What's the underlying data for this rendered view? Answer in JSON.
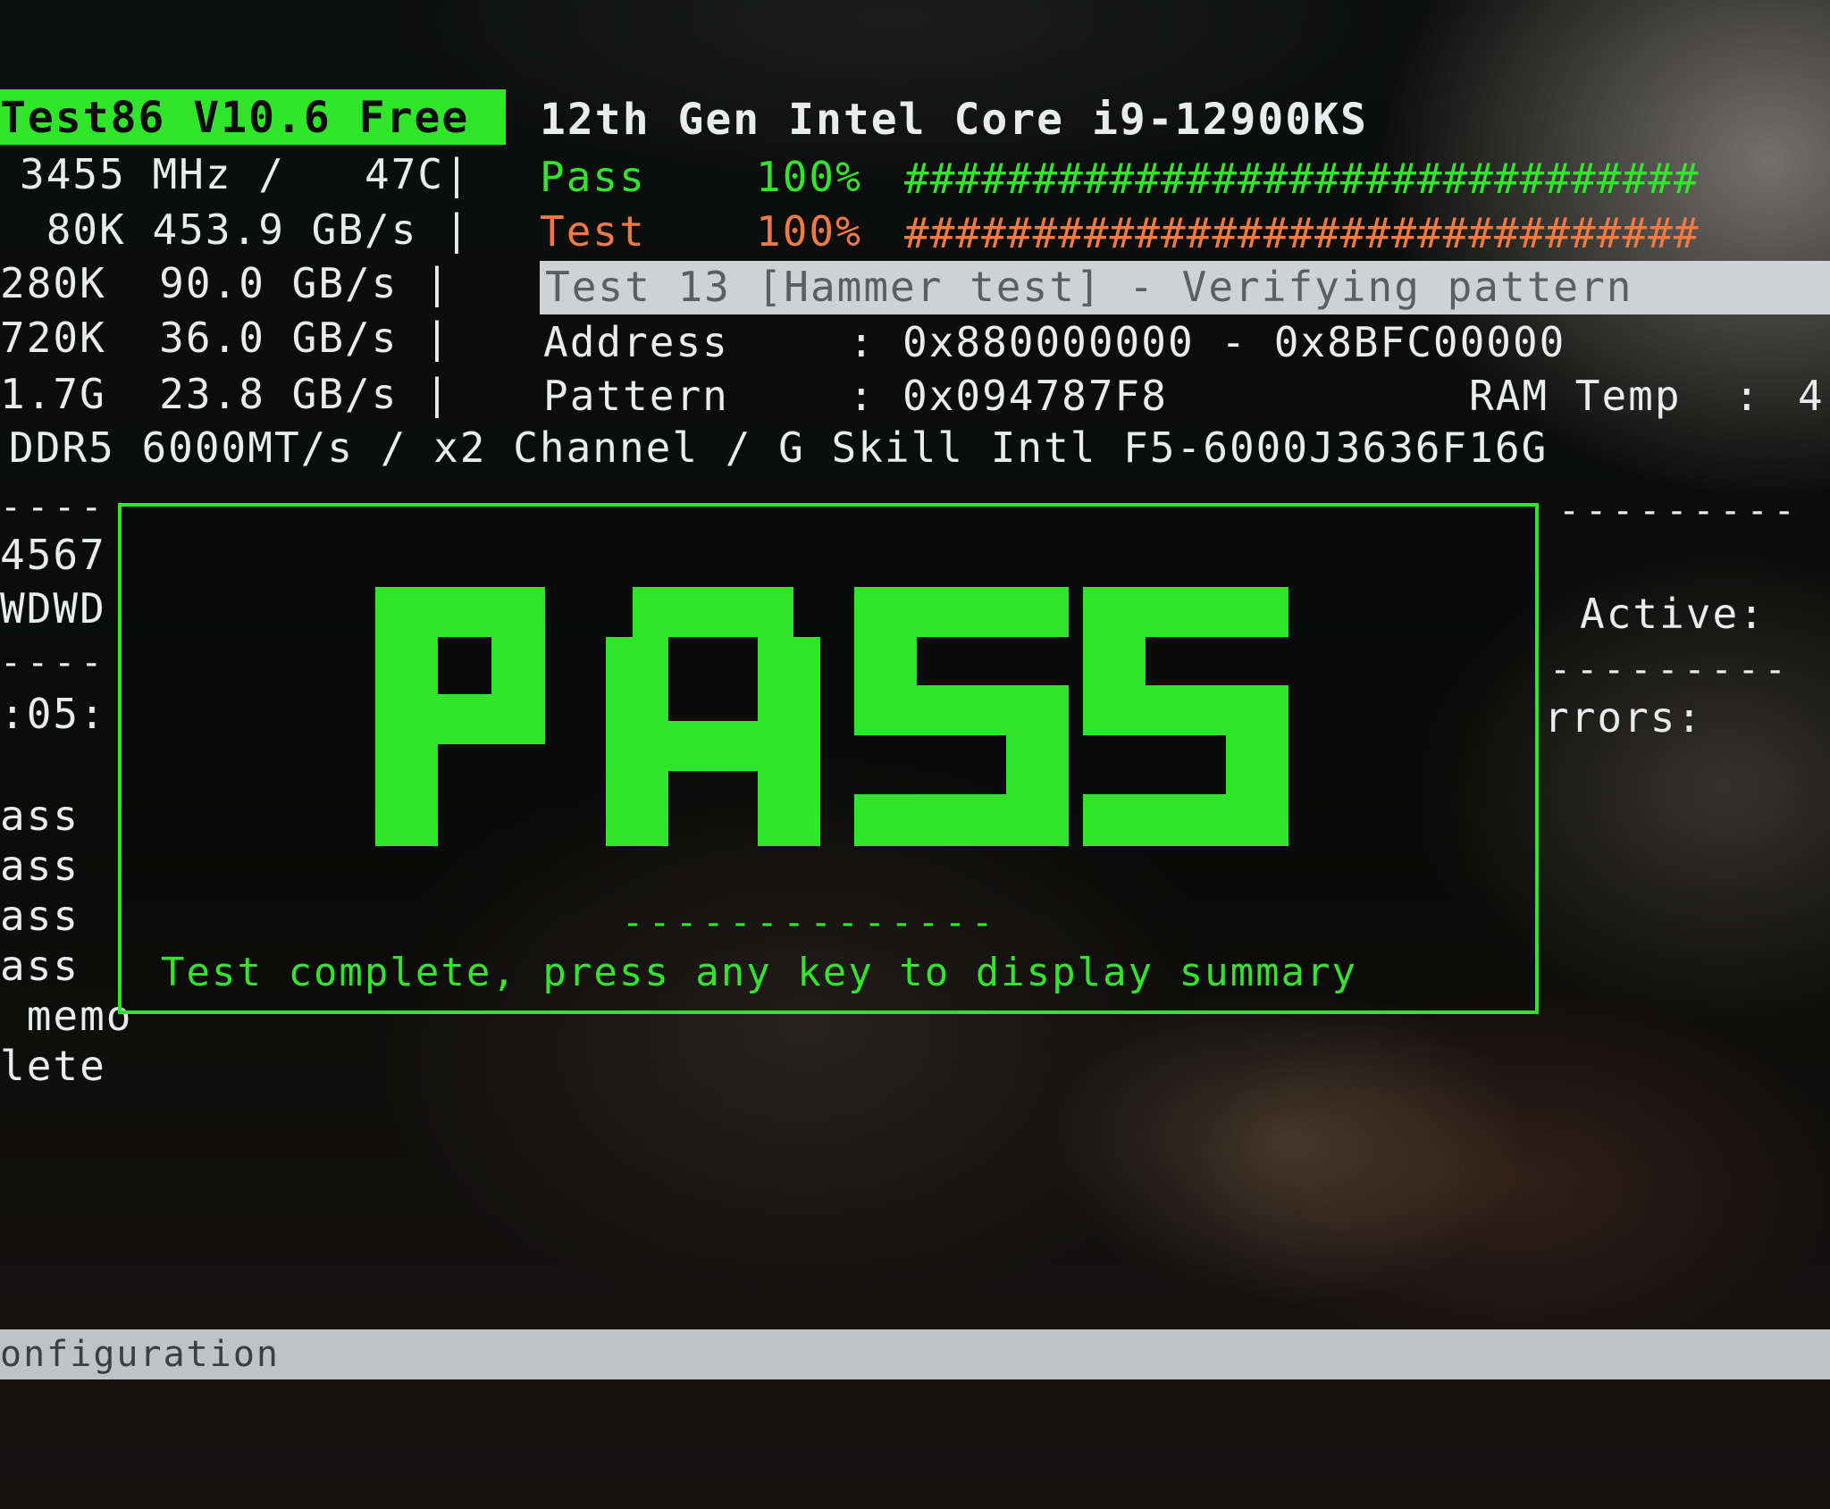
{
  "header": {
    "app_title": "Test86 V10.6 Free",
    "cpu_name": "12th Gen Intel Core i9-12900KS"
  },
  "left_stats": {
    "cpu_line": "3455 MHz /   47C|",
    "cache_l1": " 80K 453.9 GB/s |",
    "cache_l2": "280K  90.0 GB/s |",
    "cache_l3": "720K  36.0 GB/s |",
    "memory": "1.7G  23.8 GB/s |",
    "dimm": "DDR5 6000MT/s / x2 Channel / G Skill Intl F5-6000J3636F16G"
  },
  "progress": {
    "pass_label": "Pass",
    "pass_percent": "100%",
    "pass_bar": "###############################",
    "test_label": "Test",
    "test_percent": "100%",
    "test_bar": "###############################"
  },
  "current_test": "Test 13 [Hammer test] - Verifying pattern",
  "address": {
    "label": "Address",
    "colon": ":",
    "value": "0x880000000 - 0x8BFC00000"
  },
  "pattern": {
    "label": "Pattern",
    "colon": ":",
    "value": "0x094787F8"
  },
  "ram_temp": {
    "label": "RAM Temp  :",
    "value": "4"
  },
  "left_column": {
    "dash_top": "----",
    "cores_numbers": "4567",
    "cores_states": "WDWD",
    "dash_mid": "----",
    "time": ":05:",
    "log_lines": [
      "ass",
      "ass",
      "ass",
      "ass",
      " memo",
      "lete"
    ]
  },
  "right_column": {
    "dash_top": "---------",
    "active_label": "Active:",
    "dash_mid": "---------",
    "errors_label": "rrors:"
  },
  "popup": {
    "big_text": "PASS",
    "dash": "--------------",
    "message": "Test complete, press any key to display summary"
  },
  "bottom_bar": {
    "text": "onfiguration"
  },
  "colors": {
    "green": "#2fe62a",
    "orange": "#f07a44",
    "white": "#e9ecec"
  }
}
